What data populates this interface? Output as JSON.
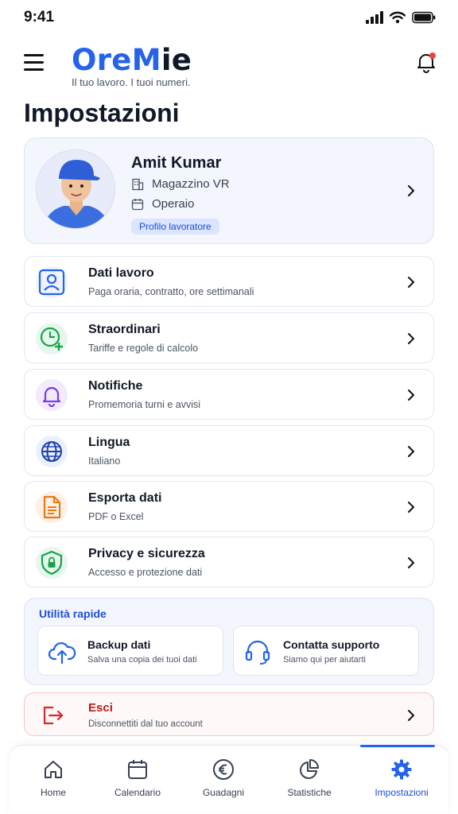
{
  "status": {
    "time": "9:41"
  },
  "header": {
    "logo_part1": "Ore",
    "logo_part2": "M",
    "logo_part3": "ie",
    "tagline": "Il tuo lavoro. I tuoi numeri."
  },
  "page": {
    "title": "Impostazioni"
  },
  "profile": {
    "name": "Amit Kumar",
    "location": "Magazzino VR",
    "role": "Operaio",
    "badge": "Profilo lavoratore"
  },
  "settings": [
    {
      "title": "Dati lavoro",
      "subtitle": "Paga oraria, contratto, ore settimanali",
      "icon": "user-card-icon"
    },
    {
      "title": "Straordinari",
      "subtitle": "Tariffe e regole di calcolo",
      "icon": "clock-plus-icon"
    },
    {
      "title": "Notifiche",
      "subtitle": "Promemoria turni e avvisi",
      "icon": "bell-icon"
    },
    {
      "title": "Lingua",
      "subtitle": "Italiano",
      "icon": "globe-icon"
    },
    {
      "title": "Esporta dati",
      "subtitle": "PDF o Excel",
      "icon": "document-icon"
    },
    {
      "title": "Privacy e sicurezza",
      "subtitle": "Accesso e protezione dati",
      "icon": "shield-lock-icon"
    }
  ],
  "quick": {
    "title": "Utilità rapide",
    "items": [
      {
        "title": "Backup dati",
        "subtitle": "Salva una copia dei tuoi dati",
        "icon": "cloud-upload-icon"
      },
      {
        "title": "Contatta supporto",
        "subtitle": "Siamo qui per aiutarti",
        "icon": "headset-icon"
      }
    ]
  },
  "logout": {
    "title": "Esci",
    "subtitle": "Disconnettiti dal tuo account",
    "icon": "logout-icon"
  },
  "tabs": [
    {
      "label": "Home",
      "icon": "home-icon"
    },
    {
      "label": "Calendario",
      "icon": "calendar-icon"
    },
    {
      "label": "Guadagni",
      "icon": "euro-icon"
    },
    {
      "label": "Statistiche",
      "icon": "pie-chart-icon"
    },
    {
      "label": "Impostazioni",
      "icon": "gear-icon",
      "active": true
    }
  ],
  "colors": {
    "accent": "#2563eb",
    "danger": "#b91c1c",
    "card_bg": "#f4f6fd"
  }
}
